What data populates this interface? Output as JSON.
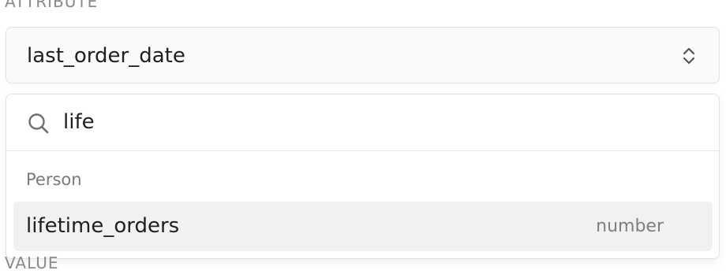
{
  "attribute": {
    "label": "ATTRIBUTE",
    "selected_value": "last_order_date",
    "chevron_icon": "chevron-up-down-icon"
  },
  "dropdown": {
    "search": {
      "icon": "search-icon",
      "value": "life"
    },
    "groups": [
      {
        "label": "Person",
        "options": [
          {
            "name": "lifetime_orders",
            "type": "number",
            "highlighted": true
          }
        ]
      }
    ]
  },
  "value_field": {
    "label": "VALUE"
  },
  "colors": {
    "option_highlight": "#f1f1f1",
    "border": "#e2e2e2",
    "muted_text": "#7a7a7a"
  }
}
